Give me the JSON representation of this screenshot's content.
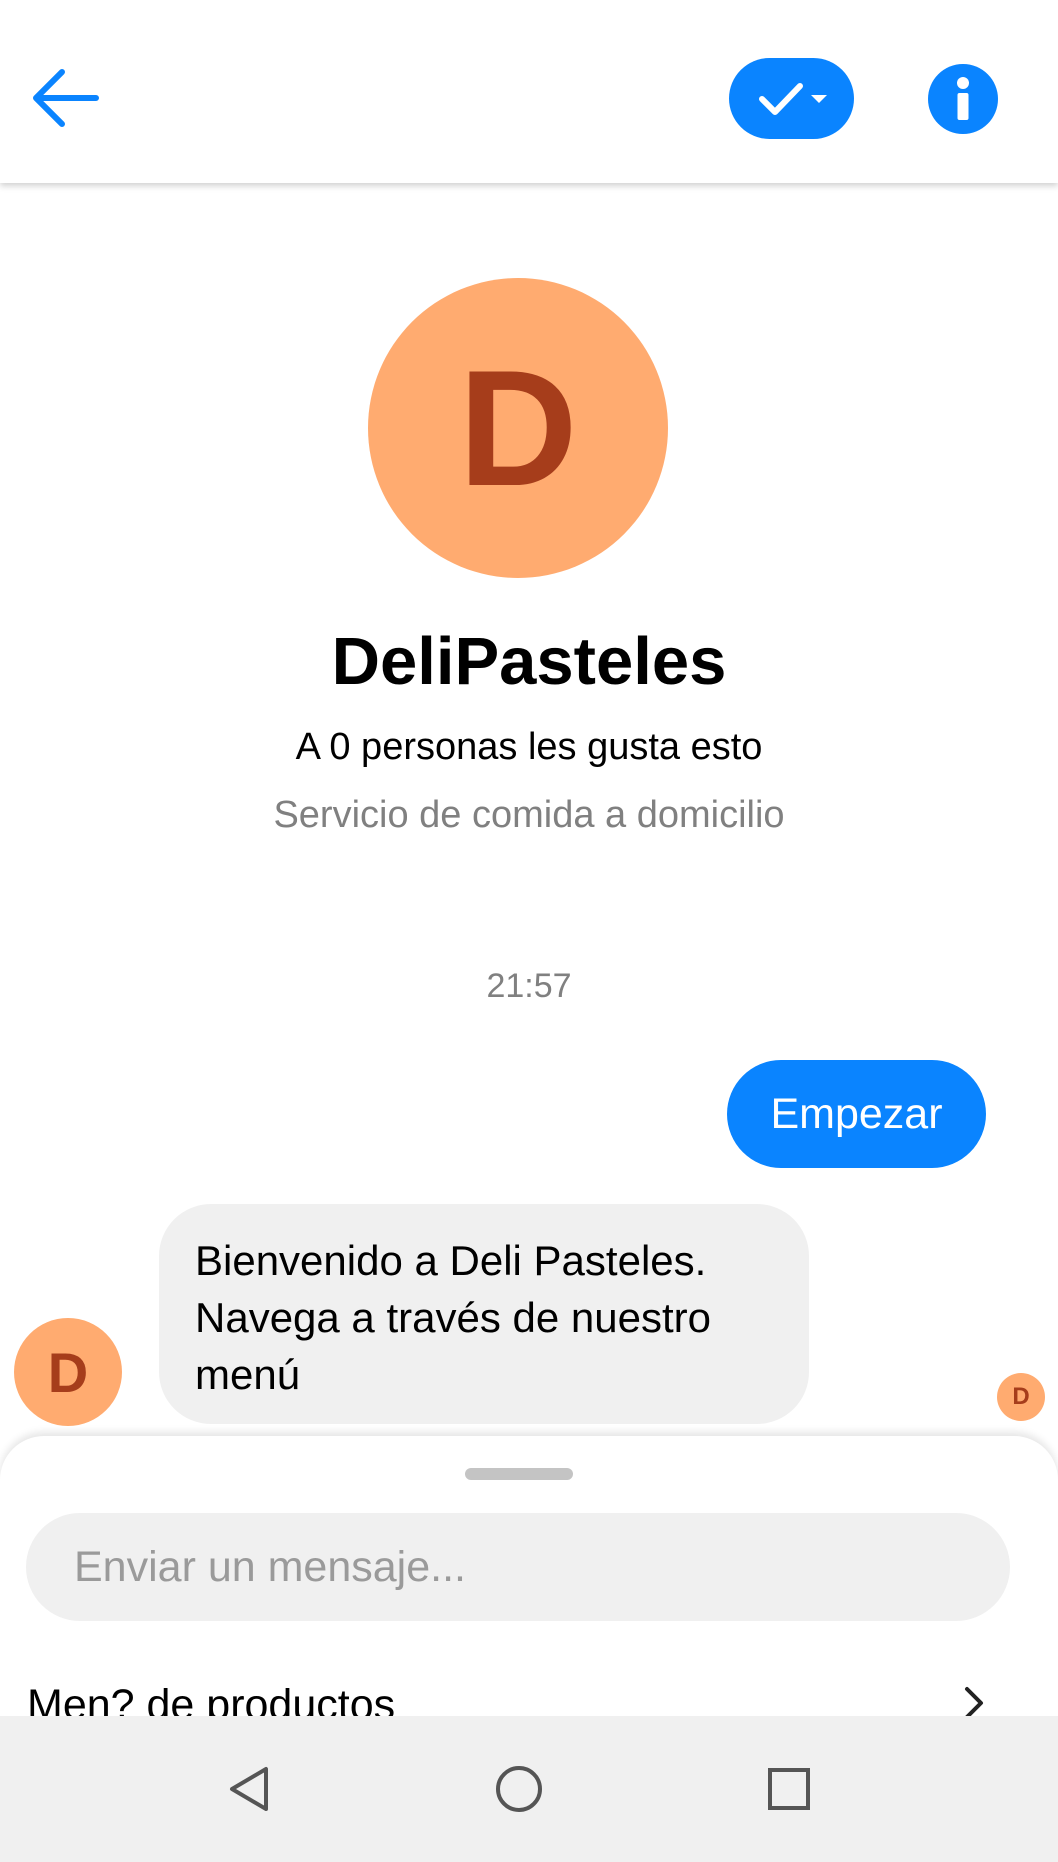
{
  "header": {
    "back_icon": "arrow-left-icon",
    "status_icon": "checkmark-dropdown-icon",
    "info_icon": "info-icon",
    "accent_color": "#0a84ff"
  },
  "profile": {
    "avatar_letter": "D",
    "avatar_color": "#ffab70",
    "avatar_letter_color": "#a63d1b",
    "name": "DeliPasteles",
    "likes": "A 0 personas les gusta esto",
    "category": "Servicio de comida a domicilio"
  },
  "conversation": {
    "timestamp": "21:57",
    "messages": [
      {
        "direction": "sent",
        "text": "Empezar"
      },
      {
        "direction": "received",
        "lines": [
          "Bienvenido a Deli Pasteles.",
          "Navega a través de nuestro",
          "menú"
        ]
      }
    ],
    "sender_avatar_letter": "D",
    "seen_avatar_letter": "D"
  },
  "composer": {
    "placeholder": "Enviar un mensaje...",
    "menu_item_label": "Men? de productos",
    "menu_chevron_icon": "chevron-right-icon"
  },
  "system_nav": {
    "back_icon": "triangle-back-icon",
    "home_icon": "circle-home-icon",
    "recents_icon": "square-recents-icon"
  }
}
